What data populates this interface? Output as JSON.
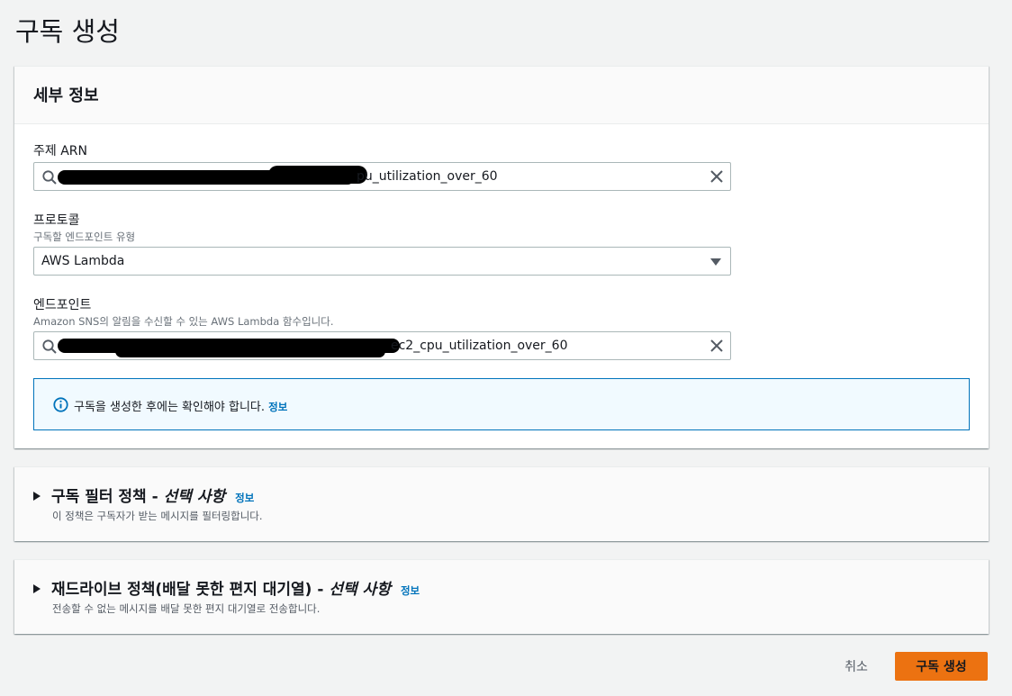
{
  "page": {
    "title": "구독 생성"
  },
  "details": {
    "header": "세부 정보",
    "topic_arn": {
      "label": "주제 ARN",
      "value_suffix": "pu_utilization_over_60"
    },
    "protocol": {
      "label": "프로토콜",
      "description": "구독할 엔드포인트 유형",
      "value": "AWS Lambda"
    },
    "endpoint": {
      "label": "엔드포인트",
      "description": "Amazon SNS의 알림을 수신할 수 있는 AWS Lambda 함수입니다.",
      "value_suffix": "ec2_cpu_utilization_over_60"
    },
    "alert": {
      "message": "구독을 생성한 후에는 확인해야 합니다.",
      "link": "정보"
    }
  },
  "filter_policy": {
    "title": "구독 필터 정책 - ",
    "optional": "선택 사항",
    "info_link": "정보",
    "description": "이 정책은 구독자가 받는 메시지를 필터링합니다."
  },
  "dlq_policy": {
    "title": "재드라이브 정책(배달 못한 편지 대기열) - ",
    "optional": "선택 사항",
    "info_link": "정보",
    "description": "전송할 수 없는 메시지를 배달 못한 편지 대기열로 전송합니다."
  },
  "actions": {
    "cancel": "취소",
    "create": "구독 생성"
  },
  "colors": {
    "primary_button": "#ec7211",
    "link": "#0073bb",
    "alert_border": "#0073bb",
    "alert_bg": "#f1faff"
  },
  "icons": {
    "search": "search-icon",
    "clear": "close-icon",
    "info": "info-icon",
    "caret": "caret-down-icon",
    "expand": "caret-right-icon"
  }
}
